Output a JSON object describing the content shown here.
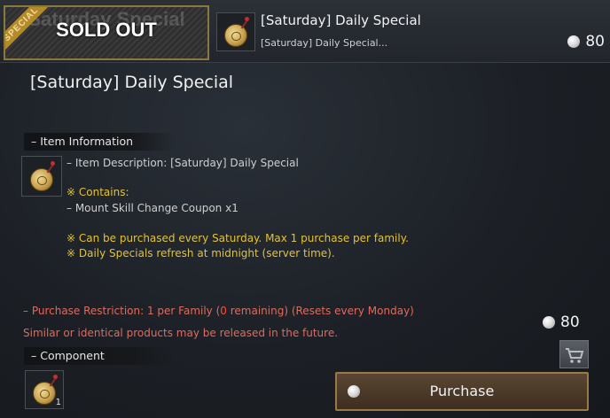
{
  "banner": {
    "ribbon_label": "SPECIAL",
    "ghost_label": "Saturday Special",
    "status_label": "SOLD OUT"
  },
  "header": {
    "title": "[Saturday] Daily Special",
    "subtitle": "[Saturday] Daily Special...",
    "price": "80",
    "currency_icon": "pearl-icon"
  },
  "panel_title": "[Saturday] Daily Special",
  "item_information": {
    "heading": "– Item Information",
    "description": "– Item Description: [Saturday] Daily Special",
    "contains_heading": "※ Contains:",
    "contains_item": "– Mount Skill Change Coupon x1",
    "note_1": "※ Can be purchased every Saturday. Max 1 purchase per family.",
    "note_2": "※ Daily Specials refresh at midnight (server time)."
  },
  "restriction": {
    "prefix": "– Purchase Restriction: 1 per Family (",
    "remaining": "0",
    "suffix": " remaining) (Resets every Monday)",
    "similar_note": "Similar or identical products may be released in the future."
  },
  "component": {
    "heading": "– Component",
    "count": "1"
  },
  "purchase": {
    "price": "80",
    "button_label": "Purchase"
  },
  "colors": {
    "accent_gold": "#9a7a44",
    "note_yellow": "#e2c23a",
    "warning_red": "#e06a5c"
  }
}
